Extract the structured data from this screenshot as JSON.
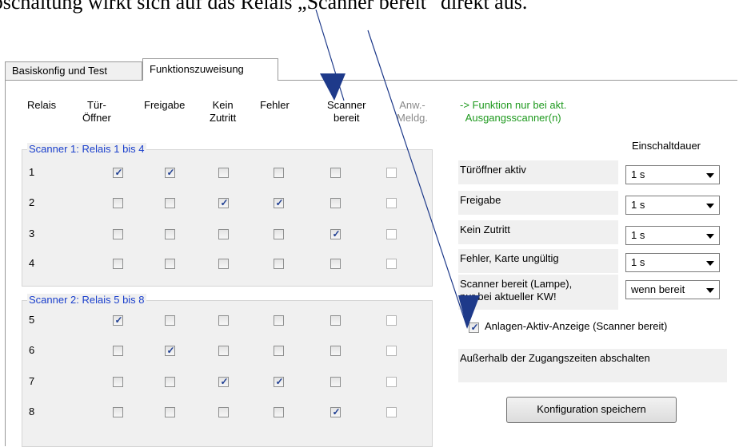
{
  "caption": "Abschaltung wirkt sich auf das Relais „Scanner bereit“ direkt aus.",
  "tabs": [
    {
      "label": "Basiskonfig und Test",
      "active": false
    },
    {
      "label": "Funktionszuweisung",
      "active": true
    }
  ],
  "headers": {
    "relais": "Relais",
    "tueroeffner_1": "Tür-",
    "tueroeffner_2": "Öffner",
    "freigabe": "Freigabe",
    "kein_1": "Kein",
    "kein_2": "Zutritt",
    "fehler": "Fehler",
    "scanner_1": "Scanner",
    "scanner_2": "bereit",
    "anw_1": "Anw.-",
    "anw_2": "Meldg.",
    "note_1": "-> Funktion nur bei akt.",
    "note_2": "Ausgangsscanner(n)"
  },
  "groups": [
    {
      "label": "Scanner 1: Relais 1 bis 4",
      "rows": [
        {
          "num": "1",
          "checks": [
            true,
            true,
            false,
            false,
            false,
            false
          ]
        },
        {
          "num": "2",
          "checks": [
            false,
            false,
            true,
            true,
            false,
            false
          ]
        },
        {
          "num": "3",
          "checks": [
            false,
            false,
            false,
            false,
            true,
            false
          ]
        },
        {
          "num": "4",
          "checks": [
            false,
            false,
            false,
            false,
            false,
            false
          ]
        }
      ]
    },
    {
      "label": "Scanner 2: Relais 5 bis 8",
      "rows": [
        {
          "num": "5",
          "checks": [
            true,
            false,
            false,
            false,
            false,
            false
          ]
        },
        {
          "num": "6",
          "checks": [
            false,
            true,
            false,
            false,
            false,
            false
          ]
        },
        {
          "num": "7",
          "checks": [
            false,
            false,
            true,
            true,
            false,
            false
          ]
        },
        {
          "num": "8",
          "checks": [
            false,
            false,
            false,
            false,
            true,
            false
          ]
        }
      ]
    }
  ],
  "duration": {
    "header": "Einschaltdauer",
    "items": [
      {
        "label": "Türöffner aktiv",
        "value": "1 s"
      },
      {
        "label": "Freigabe",
        "value": "1 s"
      },
      {
        "label": "Kein Zutritt",
        "value": "1 s"
      },
      {
        "label": "Fehler, Karte ungültig",
        "value": "1 s"
      },
      {
        "label_1": "Scanner bereit (Lampe),",
        "label_2": "nur bei aktueller KW!",
        "value": "wenn bereit"
      }
    ]
  },
  "anlagen_checkbox": {
    "label": "Anlagen-Aktiv-Anzeige (Scanner bereit)",
    "checked": true
  },
  "ausserhalb_label": "Außerhalb der Zugangszeiten abschalten",
  "save_button": "Konfiguration speichern",
  "colors": {
    "group_title": "#1a3fcc",
    "note": "#1f9a1f",
    "arrows": "#1e3a8a"
  }
}
